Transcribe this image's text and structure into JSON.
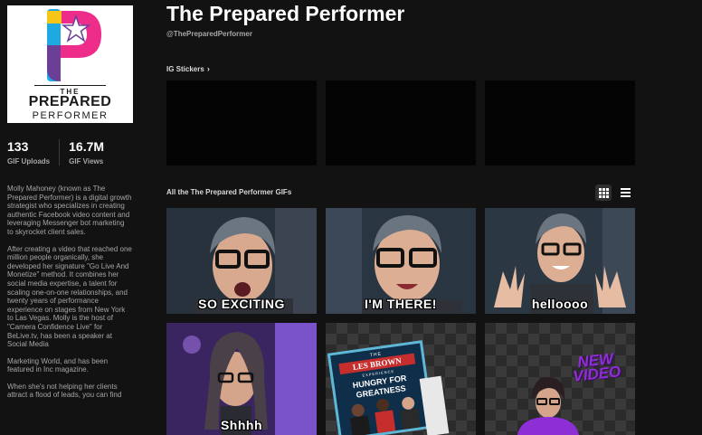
{
  "profile": {
    "logo": {
      "the": "THE",
      "prepared": "PREPARED",
      "performer": "PERFORMER",
      "colors": {
        "pink": "#ee2d8b",
        "blue": "#1fa9e1",
        "purple": "#6b3f98",
        "yellow": "#f5c518",
        "orange": "#f58220"
      }
    },
    "stats": [
      {
        "value": "133",
        "label": "GIF Uploads"
      },
      {
        "value": "16.7M",
        "label": "GIF Views"
      }
    ],
    "bio": [
      "Molly Mahoney (known as The Prepared Performer) is a digital growth strategist who specializes in creating authentic Facebook video content and leveraging Messenger bot marketing to skyrocket client sales.",
      "After creating a video that reached one million people organically, she developed her signature \"Go Live And Monetize\" method. It combines her social media expertise, a talent for scaling one-on-one relationships, and twenty years of performance experience on stages from New York to Las Vegas. Molly is the host of \"Camera Confidence Live\" for BeLive.tv, has been a speaker at Social Media",
      "Marketing World, and has been featured in Inc magazine.",
      "When she's not helping her clients attract a flood of leads, you can find"
    ]
  },
  "header": {
    "title": "The Prepared Performer",
    "handle": "@ThePreparedPerformer"
  },
  "stickers": {
    "label": "IG Stickers",
    "count": 3
  },
  "gifs": {
    "label": "All the The Prepared Performer GIFs",
    "view_grid_icon": "grid-icon",
    "view_list_icon": "list-icon",
    "items": [
      {
        "caption": "SO EXCITING"
      },
      {
        "caption": "I'M THERE!"
      },
      {
        "caption": "helloooo"
      },
      {
        "caption": "Shhhh"
      },
      {
        "book_line1": "THE",
        "book_line2": "LES BROWN",
        "book_line3": "EXPERIENCE",
        "book_line4": "HUNGRY FOR",
        "book_line5": "GREATNESS"
      },
      {
        "caption": "NEW VIDEO"
      }
    ]
  }
}
